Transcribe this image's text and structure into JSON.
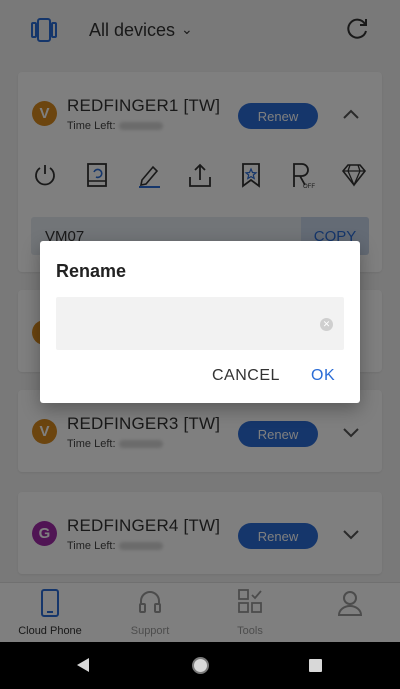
{
  "header": {
    "title": "All devices",
    "multi_icon": "multi-device-icon",
    "refresh_icon": "refresh-icon"
  },
  "devices": [
    {
      "avatar": "V",
      "avatar_color": "#d88a1e",
      "name": "REDFINGER1 [TW]",
      "time_left_label": "Time Left:",
      "renew_label": "Renew",
      "expanded": true,
      "vm_text": "VM07",
      "copy_label": "COPY"
    },
    {
      "avatar": "V",
      "avatar_color": "#d88a1e",
      "name": "REDFINGER3 [TW]",
      "time_left_label": "Time Left:",
      "renew_label": "Renew",
      "expanded": false
    },
    {
      "avatar": "G",
      "avatar_color": "#a02aa8",
      "name": "REDFINGER4 [TW]",
      "time_left_label": "Time Left:",
      "renew_label": "Renew",
      "expanded": false
    }
  ],
  "toolbar_icons": [
    "power-icon",
    "restart-icon",
    "rename-icon",
    "upload-icon",
    "bookmark-icon",
    "root-off-icon",
    "diamond-icon"
  ],
  "bottom_nav": [
    {
      "label": "Cloud Phone",
      "icon": "phone-icon",
      "active": true
    },
    {
      "label": "Support",
      "icon": "headset-icon",
      "active": false
    },
    {
      "label": "Tools",
      "icon": "tools-icon",
      "active": false
    },
    {
      "label": "",
      "icon": "profile-icon",
      "active": false
    }
  ],
  "dialog": {
    "title": "Rename",
    "input_value": "",
    "input_placeholder": "",
    "cancel_label": "CANCEL",
    "ok_label": "OK"
  },
  "colors": {
    "accent": "#2a6cd6",
    "renew": "#2a6cd6",
    "copy_bg": "#c9d7ea"
  }
}
